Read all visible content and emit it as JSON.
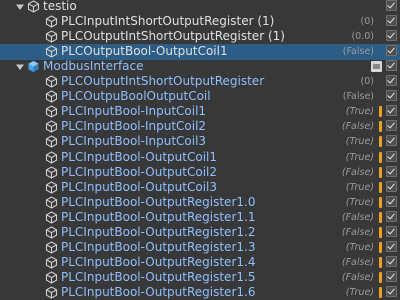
{
  "tree": {
    "rows": [
      {
        "label": "testio",
        "value": "",
        "style": "light",
        "indent": 0,
        "expandable": true,
        "icon": "gameobject-icon",
        "selected": false,
        "warn": false,
        "badge": false
      },
      {
        "label": "PLCInputIntShortOutputRegister (1)",
        "value": "(0)",
        "style": "light",
        "indent": 1,
        "expandable": false,
        "icon": "gameobject-icon",
        "selected": false,
        "warn": false,
        "badge": false
      },
      {
        "label": "PLCOutputIntShortOutputRegister (1)",
        "value": "(0.0)",
        "style": "light",
        "indent": 1,
        "expandable": false,
        "icon": "gameobject-icon",
        "selected": false,
        "warn": false,
        "badge": false
      },
      {
        "label": "PLCOutputBool-OutputCoil1",
        "value": "(False)",
        "style": "light",
        "indent": 1,
        "expandable": false,
        "icon": "gameobject-icon",
        "selected": true,
        "warn": false,
        "badge": false
      },
      {
        "label": "ModbusInterface",
        "value": "",
        "style": "blue",
        "indent": 0,
        "expandable": true,
        "icon": "prefab-icon",
        "selected": false,
        "warn": false,
        "badge": true
      },
      {
        "label": "PLCOutputIntShortOutputRegister",
        "value": "(0)",
        "style": "blue",
        "indent": 1,
        "expandable": false,
        "icon": "gameobject-icon",
        "selected": false,
        "warn": false,
        "badge": false
      },
      {
        "label": "PLCOutpuBoolOutputCoil",
        "value": "(False)",
        "style": "blue",
        "indent": 1,
        "expandable": false,
        "icon": "gameobject-icon",
        "selected": false,
        "warn": false,
        "badge": false
      },
      {
        "label": "PLCInputBool-InputCoil1",
        "value": "(True)",
        "style": "blue",
        "indent": 1,
        "expandable": false,
        "icon": "gameobject-icon",
        "selected": false,
        "warn": true,
        "badge": false
      },
      {
        "label": "PLCInputBool-InputCoil2",
        "value": "(False)",
        "style": "blue",
        "indent": 1,
        "expandable": false,
        "icon": "gameobject-icon",
        "selected": false,
        "warn": true,
        "badge": false
      },
      {
        "label": "PLCInputBool-InputCoil3",
        "value": "(True)",
        "style": "blue",
        "indent": 1,
        "expandable": false,
        "icon": "gameobject-icon",
        "selected": false,
        "warn": true,
        "badge": false
      },
      {
        "label": "PLCInputBool-OutputCoil1",
        "value": "(True)",
        "style": "blue",
        "indent": 1,
        "expandable": false,
        "icon": "gameobject-icon",
        "selected": false,
        "warn": true,
        "badge": false
      },
      {
        "label": "PLCInputBool-OutputCoil2",
        "value": "(False)",
        "style": "blue",
        "indent": 1,
        "expandable": false,
        "icon": "gameobject-icon",
        "selected": false,
        "warn": true,
        "badge": false
      },
      {
        "label": "PLCInputBool-OutputCoil3",
        "value": "(True)",
        "style": "blue",
        "indent": 1,
        "expandable": false,
        "icon": "gameobject-icon",
        "selected": false,
        "warn": true,
        "badge": false
      },
      {
        "label": "PLCInputBool-OutputRegister1.0",
        "value": "(True)",
        "style": "blue",
        "indent": 1,
        "expandable": false,
        "icon": "gameobject-icon",
        "selected": false,
        "warn": true,
        "badge": false
      },
      {
        "label": "PLCInputBool-OutputRegister1.1",
        "value": "(False)",
        "style": "blue",
        "indent": 1,
        "expandable": false,
        "icon": "gameobject-icon",
        "selected": false,
        "warn": true,
        "badge": false
      },
      {
        "label": "PLCInputBool-OutputRegister1.2",
        "value": "(False)",
        "style": "blue",
        "indent": 1,
        "expandable": false,
        "icon": "gameobject-icon",
        "selected": false,
        "warn": true,
        "badge": false
      },
      {
        "label": "PLCInputBool-OutputRegister1.3",
        "value": "(True)",
        "style": "blue",
        "indent": 1,
        "expandable": false,
        "icon": "gameobject-icon",
        "selected": false,
        "warn": true,
        "badge": false
      },
      {
        "label": "PLCInputBool-OutputRegister1.4",
        "value": "(False)",
        "style": "blue",
        "indent": 1,
        "expandable": false,
        "icon": "gameobject-icon",
        "selected": false,
        "warn": true,
        "badge": false
      },
      {
        "label": "PLCInputBool-OutputRegister1.5",
        "value": "(False)",
        "style": "blue",
        "indent": 1,
        "expandable": false,
        "icon": "gameobject-icon",
        "selected": false,
        "warn": true,
        "badge": false
      },
      {
        "label": "PLCInputBool-OutputRegister1.6",
        "value": "(True)",
        "style": "blue",
        "indent": 1,
        "expandable": false,
        "icon": "gameobject-icon",
        "selected": false,
        "warn": true,
        "badge": false
      }
    ]
  },
  "colors": {
    "background": "#383838",
    "selection": "#2c5d87",
    "text_light": "#e0e0e0",
    "text_blue": "#8fbfff",
    "warning": "#f0a020"
  }
}
